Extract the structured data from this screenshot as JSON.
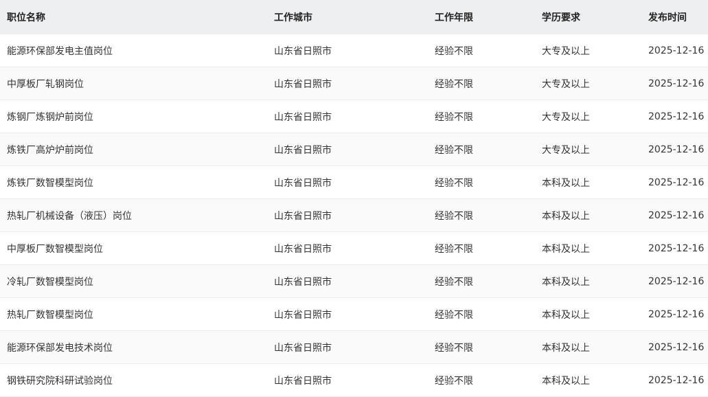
{
  "table": {
    "headers": [
      "职位名称",
      "工作城市",
      "工作年限",
      "学历要求",
      "发布时间"
    ],
    "rows": [
      [
        "能源环保部发电主值岗位",
        "山东省日照市",
        "经验不限",
        "大专及以上",
        "2025-12-16"
      ],
      [
        "中厚板厂轧钢岗位",
        "山东省日照市",
        "经验不限",
        "大专及以上",
        "2025-12-16"
      ],
      [
        "炼钢厂炼钢炉前岗位",
        "山东省日照市",
        "经验不限",
        "大专及以上",
        "2025-12-16"
      ],
      [
        "炼铁厂高炉炉前岗位",
        "山东省日照市",
        "经验不限",
        "大专及以上",
        "2025-12-16"
      ],
      [
        "炼铁厂数智模型岗位",
        "山东省日照市",
        "经验不限",
        "本科及以上",
        "2025-12-16"
      ],
      [
        "热轧厂机械设备（液压）岗位",
        "山东省日照市",
        "经验不限",
        "本科及以上",
        "2025-12-16"
      ],
      [
        "中厚板厂数智模型岗位",
        "山东省日照市",
        "经验不限",
        "本科及以上",
        "2025-12-16"
      ],
      [
        "冷轧厂数智模型岗位",
        "山东省日照市",
        "经验不限",
        "本科及以上",
        "2025-12-16"
      ],
      [
        "热轧厂数智模型岗位",
        "山东省日照市",
        "经验不限",
        "本科及以上",
        "2025-12-16"
      ],
      [
        "能源环保部发电技术岗位",
        "山东省日照市",
        "经验不限",
        "本科及以上",
        "2025-12-16"
      ],
      [
        "钢铁研究院科研试验岗位",
        "山东省日照市",
        "经验不限",
        "本科及以上",
        "2025-12-16"
      ]
    ]
  }
}
